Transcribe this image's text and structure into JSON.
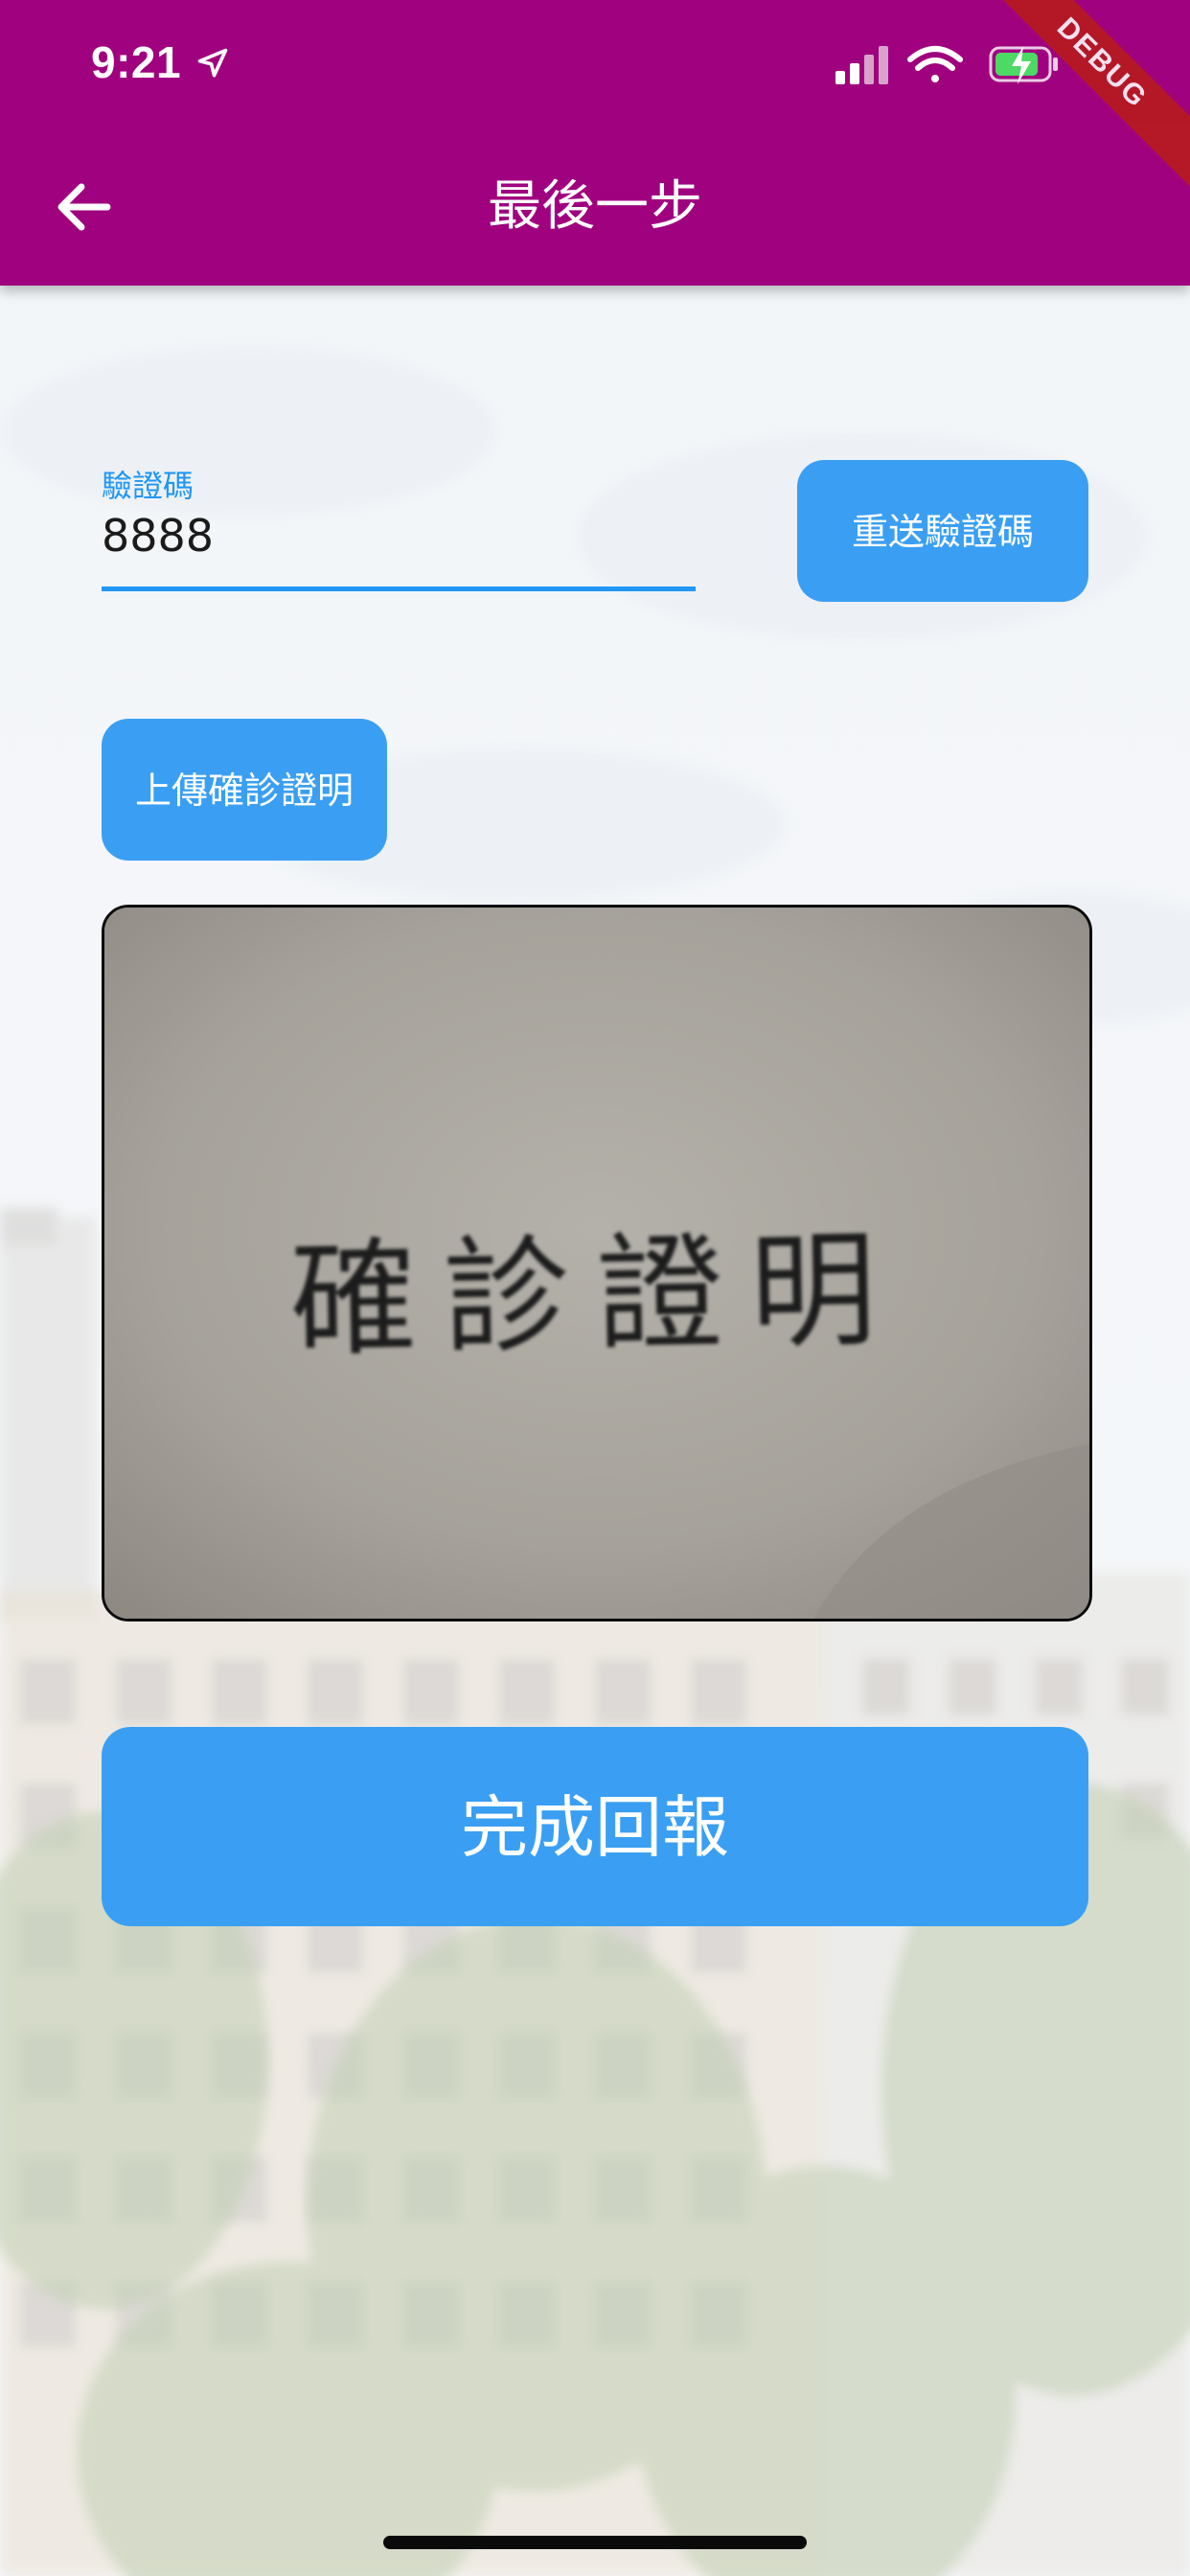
{
  "status_bar": {
    "time": "9:21",
    "icons": [
      "location-arrow-icon",
      "signal-icon",
      "wifi-icon",
      "battery-charging-icon"
    ]
  },
  "debug_banner": "DEBUG",
  "app_bar": {
    "title": "最後一步",
    "back_icon": "arrow-left-icon",
    "background_color": "#a0027f"
  },
  "verification": {
    "label": "驗證碼",
    "value": "8888",
    "resend_label": "重送驗證碼"
  },
  "upload": {
    "label": "上傳確診證明"
  },
  "photo": {
    "handwritten_text": "確診證明"
  },
  "submit": {
    "label": "完成回報"
  },
  "colors": {
    "accent": "#2196f3",
    "button": "#3a9ff2",
    "text_on_button": "#ffffff"
  }
}
